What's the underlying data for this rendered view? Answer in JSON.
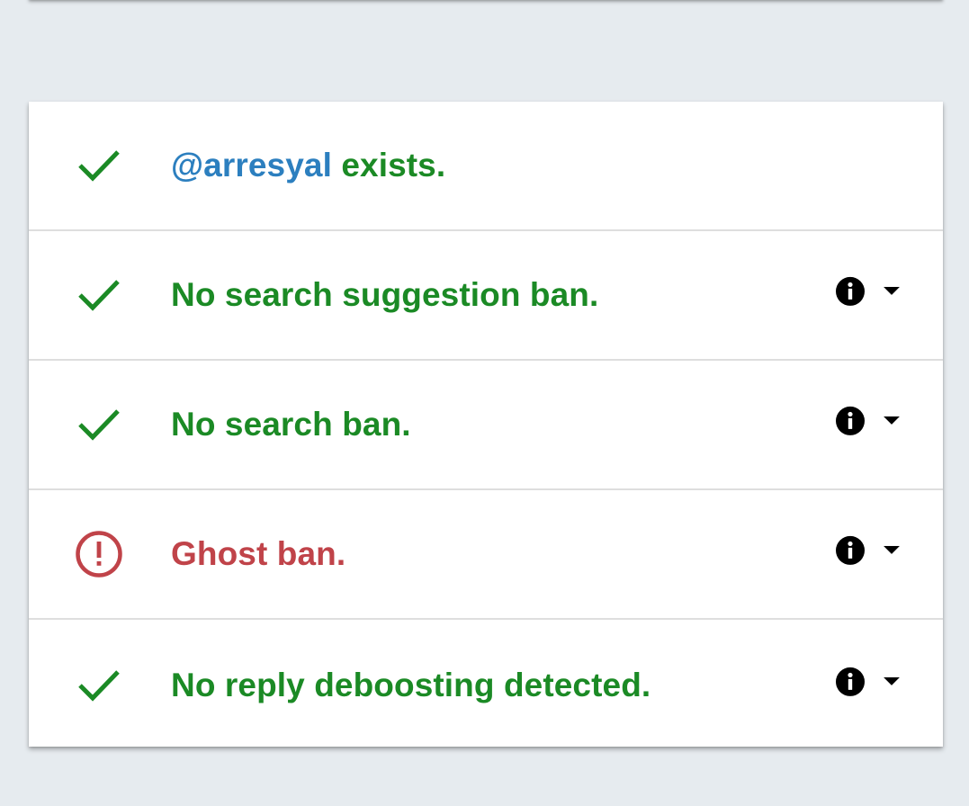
{
  "colors": {
    "success": "#1b8a25",
    "error": "#c04349",
    "handle": "#2c7fbf",
    "icon": "#000000",
    "background": "#e6ebef"
  },
  "results": [
    {
      "status": "success",
      "icon": "check-icon",
      "handle": "@arresyal",
      "text": " exists.",
      "has_actions": false
    },
    {
      "status": "success",
      "icon": "check-icon",
      "text": "No search suggestion ban.",
      "has_actions": true
    },
    {
      "status": "success",
      "icon": "check-icon",
      "text": "No search ban.",
      "has_actions": true
    },
    {
      "status": "error",
      "icon": "alert-circle-icon",
      "text": "Ghost ban.",
      "has_actions": true
    },
    {
      "status": "success",
      "icon": "check-icon",
      "text": "No reply deboosting detected.",
      "has_actions": true
    }
  ]
}
